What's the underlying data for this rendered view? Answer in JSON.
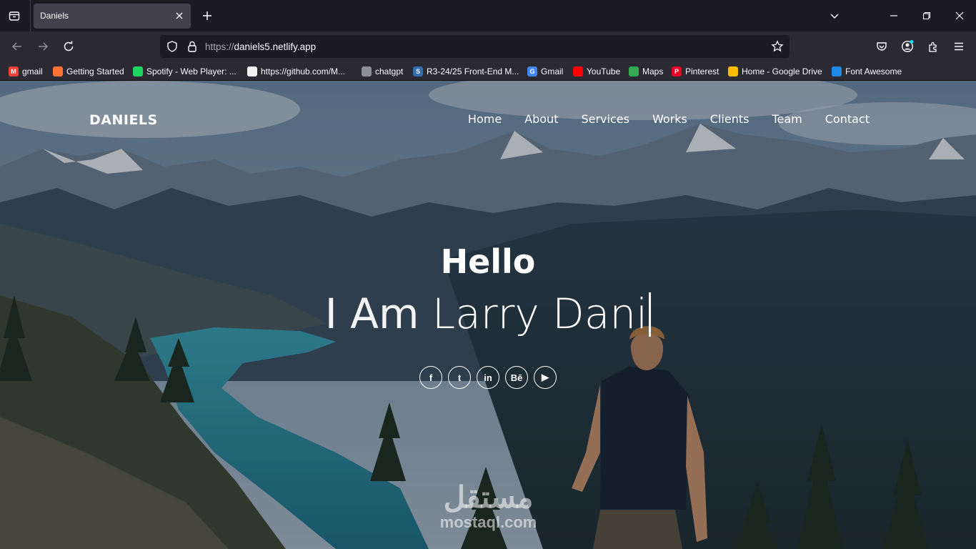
{
  "tab": {
    "title": "Daniels"
  },
  "url": {
    "prefix": "https://",
    "host": "daniels5.netlify.app"
  },
  "bookmarks": [
    {
      "label": "gmail",
      "color": "#ea4335",
      "glyph": "M"
    },
    {
      "label": "Getting Started",
      "color": "#ff7139",
      "glyph": ""
    },
    {
      "label": "Spotify - Web Player: ...",
      "color": "#1ed760",
      "glyph": ""
    },
    {
      "label": "https://github.com/M...",
      "color": "#f0f0f0",
      "glyph": ""
    },
    {
      "label": "chatgpt",
      "color": "#8a8f98",
      "glyph": ""
    },
    {
      "label": "R3-24/25 Front-End M...",
      "color": "#2f6fb0",
      "glyph": "S"
    },
    {
      "label": "Gmail",
      "color": "#4285f4",
      "glyph": "G"
    },
    {
      "label": "YouTube",
      "color": "#ff0000",
      "glyph": ""
    },
    {
      "label": "Maps",
      "color": "#34a853",
      "glyph": ""
    },
    {
      "label": "Pinterest",
      "color": "#e60023",
      "glyph": "P"
    },
    {
      "label": "Home - Google Drive",
      "color": "#fbbc04",
      "glyph": ""
    },
    {
      "label": "Font Awesome",
      "color": "#228ae6",
      "glyph": ""
    }
  ],
  "site": {
    "brand": "DANIELS",
    "menu": [
      "Home",
      "About",
      "Services",
      "Works",
      "Clients",
      "Team",
      "Contact"
    ],
    "hero": {
      "greeting": "Hello",
      "lead": "I Am ",
      "typed": "Larry Dani"
    },
    "socials": [
      {
        "name": "facebook-icon",
        "glyph": "f"
      },
      {
        "name": "twitter-icon",
        "glyph": "t"
      },
      {
        "name": "linkedin-icon",
        "glyph": "in"
      },
      {
        "name": "behance-icon",
        "glyph": "Bē"
      },
      {
        "name": "youtube-icon",
        "glyph": "▶"
      }
    ]
  },
  "watermark": {
    "arabic": "مستقل",
    "latin": "mostaql.com"
  }
}
